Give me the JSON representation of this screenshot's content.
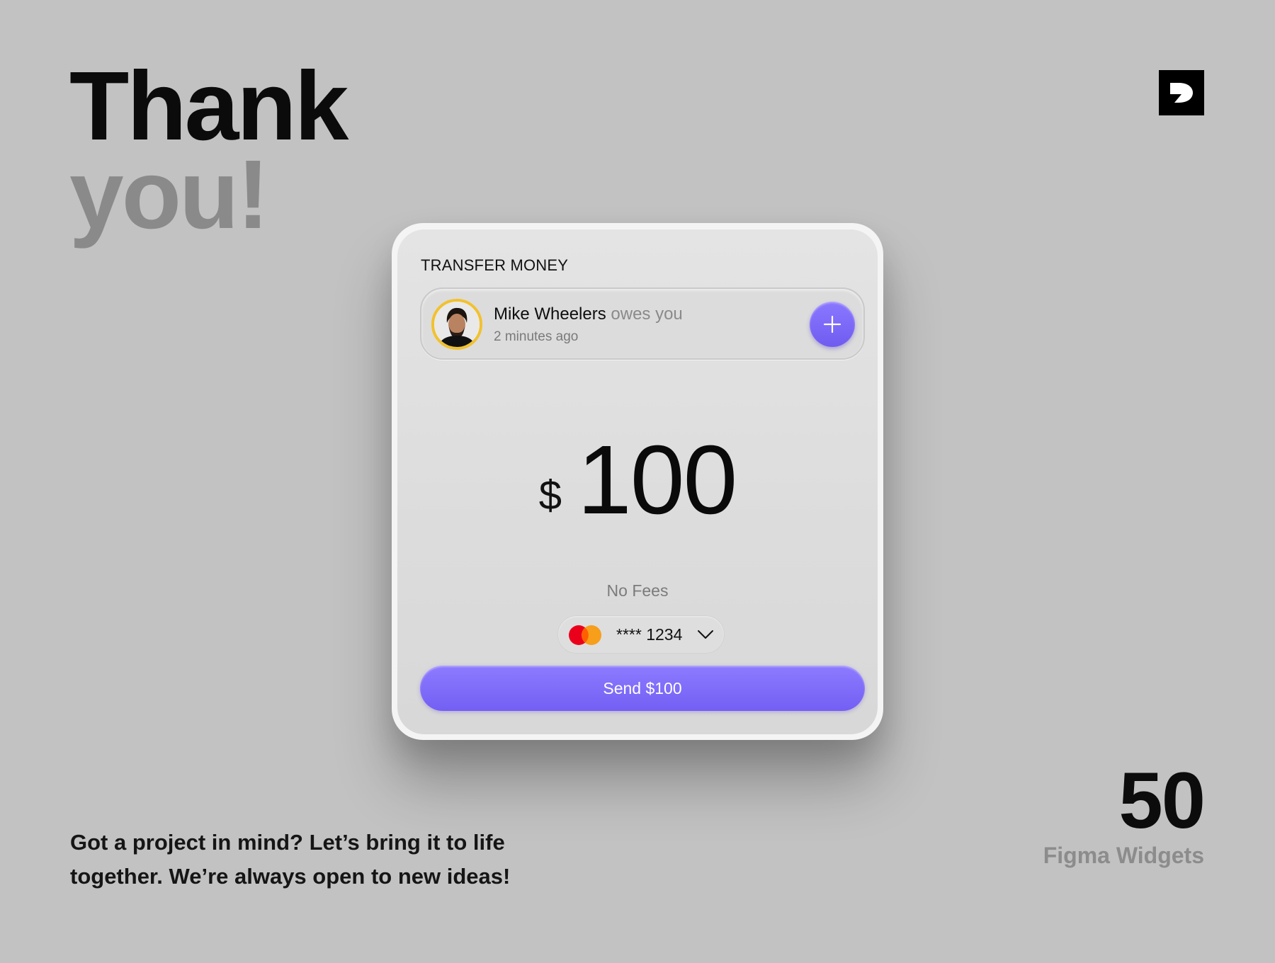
{
  "headline": {
    "line1": "Thank",
    "line2": "you!"
  },
  "brand": {
    "logo_icon": "brand-logo-icon"
  },
  "widget": {
    "title": "TRANSFER MONEY",
    "notification": {
      "name": "Mike Wheelers",
      "suffix": "owes you",
      "time": "2 minutes ago",
      "avatar_icon": "person-avatar",
      "add_icon": "plus-icon"
    },
    "amount": {
      "currency": "$",
      "value": "100"
    },
    "fees_label": "No Fees",
    "payment_card": {
      "brand_icon": "mastercard-icon",
      "number": "**** 1234",
      "dropdown_icon": "chevron-down-icon"
    },
    "send_label": "Send $100",
    "colors": {
      "accent": "#7b68f7",
      "avatar_ring": "#f2c12e",
      "mc_red": "#eb001b",
      "mc_orange": "#f79e1b"
    }
  },
  "tagline": "Got a project in mind? Let’s bring it to life together. We’re always open to new ideas!",
  "stat": {
    "number": "50",
    "label": "Figma Widgets"
  }
}
